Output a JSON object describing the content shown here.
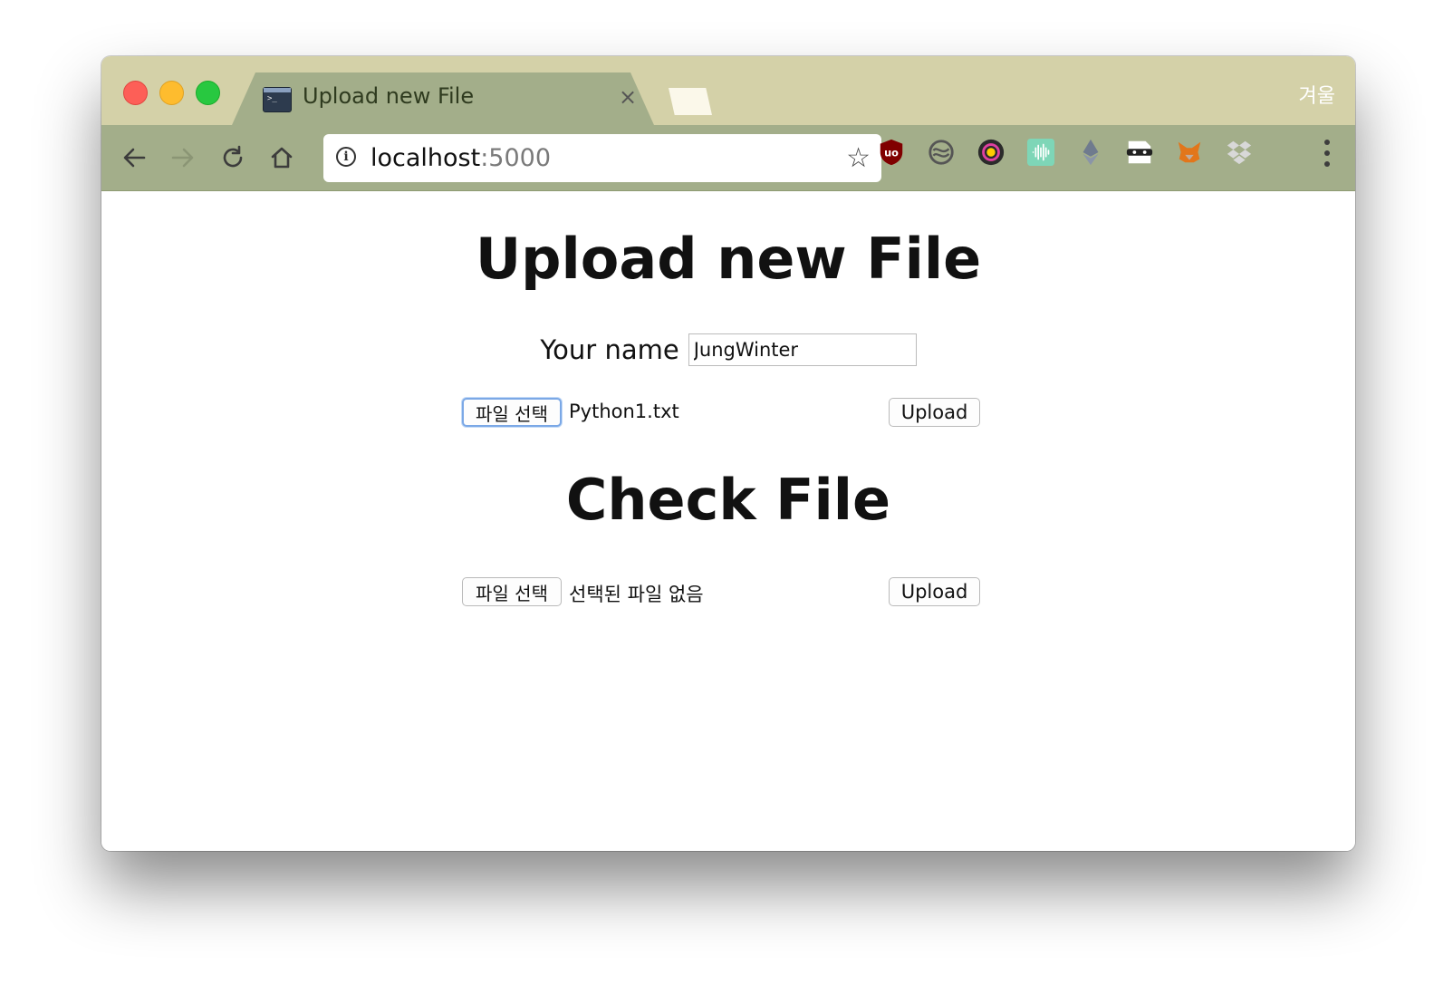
{
  "browser": {
    "tab_title": "Upload new File",
    "tab_close": "×",
    "profile_name": "겨울",
    "url_host": "localhost",
    "url_port": ":5000",
    "bookmark_star": "☆",
    "extensions": [
      "ublock-origin-icon",
      "sync-icon",
      "color-picker-icon",
      "audio-icon",
      "ethereum-icon",
      "incognito-mask-icon",
      "metamask-icon",
      "dropbox-icon"
    ]
  },
  "page": {
    "upload_heading": "Upload new File",
    "name_label": "Your name",
    "name_value": "JungWinter",
    "upload_form": {
      "choose_label": "파일 선택",
      "file_name": "Python1.txt",
      "submit_label": "Upload"
    },
    "check_heading": "Check File",
    "check_form": {
      "choose_label": "파일 선택",
      "file_name": "선택된 파일 없음",
      "submit_label": "Upload"
    }
  }
}
